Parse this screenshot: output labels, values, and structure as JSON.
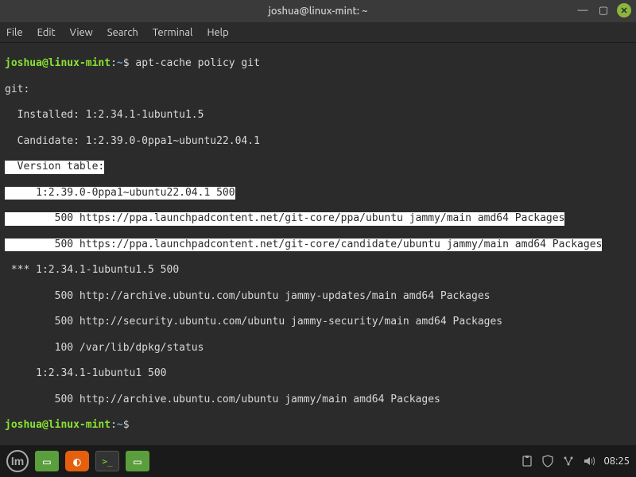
{
  "titlebar": {
    "title": "joshua@linux-mint: ~"
  },
  "menubar": {
    "file": "File",
    "edit": "Edit",
    "view": "View",
    "search": "Search",
    "terminal": "Terminal",
    "help": "Help"
  },
  "prompt": {
    "user_host": "joshua@linux-mint",
    "sep": ":",
    "path": "~",
    "sigil": "$"
  },
  "command": "apt-cache policy git",
  "output": {
    "pkg": "git:",
    "installed": "  Installed: 1:2.34.1-1ubuntu1.5",
    "candidate": "  Candidate: 1:2.39.0-0ppa1~ubuntu22.04.1",
    "version_table": "  Version table:",
    "v1_header": "     1:2.39.0-0ppa1~ubuntu22.04.1 500",
    "v1_src1": "        500 https://ppa.launchpadcontent.net/git-core/ppa/ubuntu jammy/main amd64 Packages",
    "v1_src2": "        500 https://ppa.launchpadcontent.net/git-core/candidate/ubuntu jammy/main amd64 Packages",
    "v2_header": " *** 1:2.34.1-1ubuntu1.5 500",
    "v2_src1": "        500 http://archive.ubuntu.com/ubuntu jammy-updates/main amd64 Packages",
    "v2_src2": "        500 http://security.ubuntu.com/ubuntu jammy-security/main amd64 Packages",
    "v2_src3": "        100 /var/lib/dpkg/status",
    "v3_header": "     1:2.34.1-1ubuntu1 500",
    "v3_src1": "        500 http://archive.ubuntu.com/ubuntu jammy/main amd64 Packages"
  },
  "taskbar": {
    "clock": "08:25",
    "mint_label": "lm"
  }
}
